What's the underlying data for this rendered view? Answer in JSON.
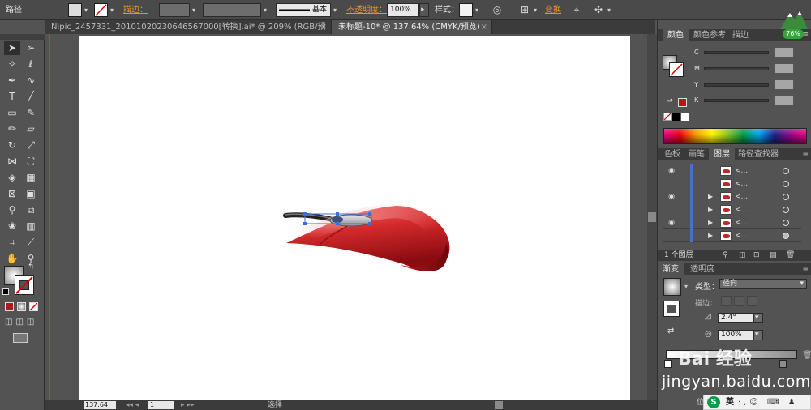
{
  "control_bar": {
    "object_type": "路径",
    "stroke_label": "描边：",
    "stroke_line_label": "基本",
    "opacity_label": "不透明度：",
    "opacity_value": "100%",
    "style_label": "样式：",
    "transform_label": "变换"
  },
  "tabs": [
    {
      "label": "Nipic_2457331_20101020230646567000[转换].ai* @ 209% (RGB/预览)"
    },
    {
      "label": "未标题-10* @ 137.64% (CMYK/预览)"
    }
  ],
  "color_panel": {
    "tabs": [
      "颜色",
      "颜色参考",
      "描边"
    ],
    "channels": [
      "C",
      "M",
      "Y",
      "K"
    ]
  },
  "layers_panel": {
    "tabs": [
      "色板",
      "画笔",
      "图层",
      "路径查找器"
    ],
    "rows": [
      {
        "name": "<...",
        "visible": true,
        "expand": false,
        "target_on": false
      },
      {
        "name": "<...",
        "visible": false,
        "expand": false,
        "target_on": false
      },
      {
        "name": "<...",
        "visible": true,
        "expand": true,
        "target_on": false
      },
      {
        "name": "<...",
        "visible": false,
        "expand": true,
        "target_on": false
      },
      {
        "name": "<...",
        "visible": true,
        "expand": true,
        "target_on": false
      },
      {
        "name": "<...",
        "visible": false,
        "expand": true,
        "target_on": true
      }
    ],
    "footer": "1 个图层"
  },
  "gradient_panel": {
    "tabs": [
      "渐变",
      "透明度"
    ],
    "type_label": "类型：",
    "type_value": "径向",
    "stroke_label": "描边：",
    "angle_value": "2.4°",
    "ratio_value": "100%",
    "location_label": "位置"
  },
  "statusbar": {
    "zoom": "137.64",
    "page": "1",
    "mode": "选择"
  },
  "watermark": {
    "logo": "Bai 经验",
    "url": "jingyan.baidu.com"
  },
  "ime": {
    "icon": "S",
    "lang": "英",
    "rest": "·,☺ ⌨ ♟ ⚑ ▦"
  },
  "perf": {
    "pct": "76%"
  },
  "colors": {
    "mouse_red": "#d42a2c",
    "fill_red": "#b0181c",
    "accent_orange": "#e8922a"
  }
}
